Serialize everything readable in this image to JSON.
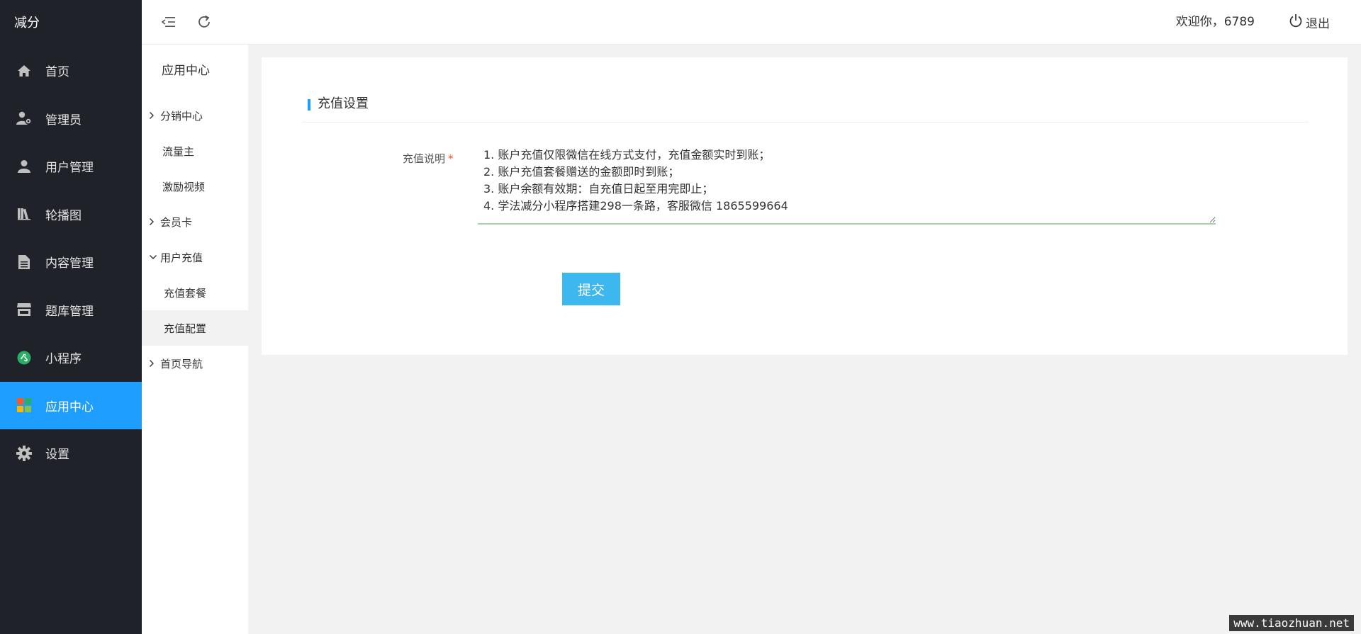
{
  "brand": "减分",
  "sidebar": {
    "items": [
      {
        "label": "首页",
        "icon": "home-icon"
      },
      {
        "label": "管理员",
        "icon": "admin-user-icon"
      },
      {
        "label": "用户管理",
        "icon": "user-icon"
      },
      {
        "label": "轮播图",
        "icon": "books-icon"
      },
      {
        "label": "内容管理",
        "icon": "document-icon"
      },
      {
        "label": "题库管理",
        "icon": "store-icon"
      },
      {
        "label": "小程序",
        "icon": "mini-program-icon"
      },
      {
        "label": "应用中心",
        "icon": "app-grid-icon"
      },
      {
        "label": "设置",
        "icon": "gear-icon"
      }
    ],
    "active_index": 7,
    "accent_color": "#1e9fff",
    "bg_color": "#20222a"
  },
  "submenu": {
    "title": "应用中心",
    "items": [
      {
        "label": "分销中心",
        "type": "collapsed"
      },
      {
        "label": "流量主",
        "type": "leaf"
      },
      {
        "label": "激励视频",
        "type": "leaf"
      },
      {
        "label": "会员卡",
        "type": "collapsed"
      },
      {
        "label": "用户充值",
        "type": "expanded"
      },
      {
        "label": "充值套餐",
        "type": "child"
      },
      {
        "label": "充值配置",
        "type": "child",
        "selected": true
      },
      {
        "label": "首页导航",
        "type": "collapsed"
      }
    ]
  },
  "topbar": {
    "collapse_icon": "menu-collapse-icon",
    "refresh_icon": "refresh-icon",
    "welcome": "欢迎你，6789",
    "logout_label": "退出",
    "logout_icon": "power-icon"
  },
  "main": {
    "section_title": "充值设置",
    "form": {
      "label": "充值说明",
      "required_mark": "*",
      "value": "1. 账户充值仅限微信在线方式支付，充值金额实时到账；\n2. 账户充值套餐赠送的金额即时到账；\n3. 账户余额有效期：自充值日起至用完即止；\n4. 学法减分小程序搭建298一条路，客服微信 1865599664",
      "submit_label": "提交"
    }
  },
  "watermark": "www.tiaozhuan.net"
}
